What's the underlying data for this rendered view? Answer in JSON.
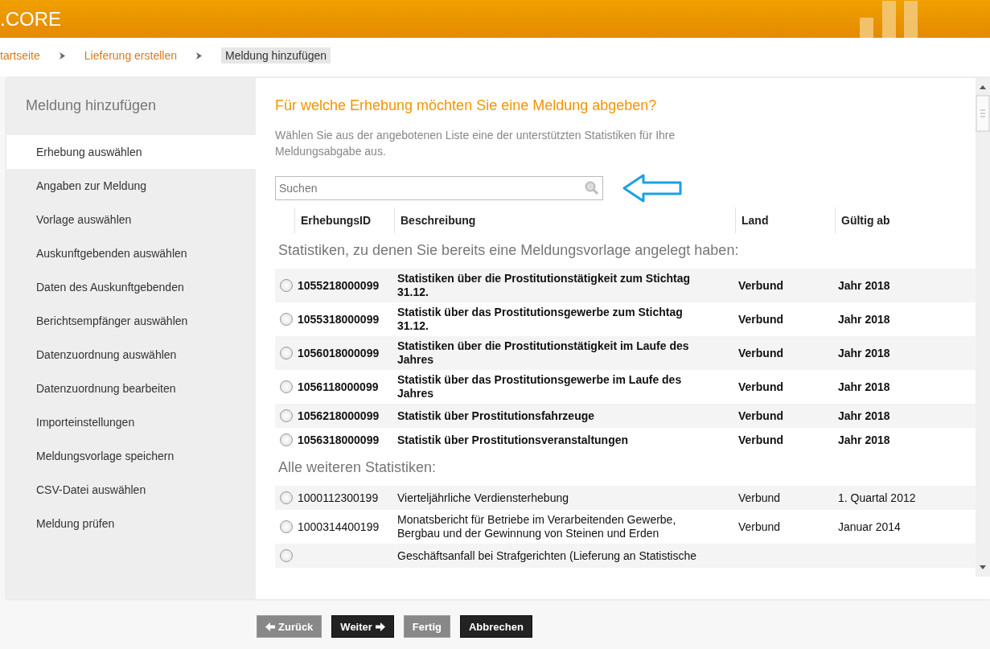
{
  "header": {
    "logo": ".CORE"
  },
  "breadcrumb": [
    {
      "label": "tartseite",
      "current": false
    },
    {
      "label": "Lieferung erstellen",
      "current": false
    },
    {
      "label": "Meldung hinzufügen",
      "current": true
    }
  ],
  "sidebar": {
    "title": "Meldung hinzufügen",
    "items": [
      {
        "label": "Erhebung auswählen",
        "selected": true
      },
      {
        "label": "Angaben zur Meldung",
        "selected": false
      },
      {
        "label": "Vorlage auswählen",
        "selected": false
      },
      {
        "label": "Auskunftgebenden auswählen",
        "selected": false
      },
      {
        "label": "Daten des Auskunftgebenden",
        "selected": false
      },
      {
        "label": "Berichtsempfänger auswählen",
        "selected": false
      },
      {
        "label": "Datenzuordnung auswählen",
        "selected": false
      },
      {
        "label": "Datenzuordnung bearbeiten",
        "selected": false
      },
      {
        "label": "Importeinstellungen",
        "selected": false
      },
      {
        "label": "Meldungsvorlage speichern",
        "selected": false
      },
      {
        "label": "CSV-Datei auswählen",
        "selected": false
      },
      {
        "label": "Meldung prüfen",
        "selected": false
      }
    ]
  },
  "content": {
    "heading": "Für welche Erhebung möchten Sie eine Meldung abgeben?",
    "intro": "Wählen Sie aus der angebotenen Liste eine der unterstützten Statistiken für Ihre Meldungsabgabe aus.",
    "search": {
      "placeholder": "Suchen"
    },
    "table": {
      "columns": [
        "ErhebungsID",
        "Beschreibung",
        "Land",
        "Gültig ab"
      ],
      "groups": [
        {
          "title": "Statistiken, zu denen Sie bereits eine Meldungsvorlage angelegt haben:",
          "bold": true,
          "rows": [
            {
              "id": "1055218000099",
              "description": "Statistiken über die Prostitutionstätigkeit zum Stichtag 31.12.",
              "land": "Verbund",
              "valid_from": "Jahr 2018",
              "selected": false
            },
            {
              "id": "1055318000099",
              "description": "Statistik über das Prostitutionsgewerbe zum Stichtag 31.12.",
              "land": "Verbund",
              "valid_from": "Jahr 2018",
              "selected": false
            },
            {
              "id": "1056018000099",
              "description": "Statistiken über die Prostitutionstätigkeit im Laufe des Jahres",
              "land": "Verbund",
              "valid_from": "Jahr 2018",
              "selected": false
            },
            {
              "id": "1056118000099",
              "description": "Statistik über das Prostitutionsgewerbe im Laufe des Jahres",
              "land": "Verbund",
              "valid_from": "Jahr 2018",
              "selected": false
            },
            {
              "id": "1056218000099",
              "description": "Statistik über Prostitutionsfahrzeuge",
              "land": "Verbund",
              "valid_from": "Jahr 2018",
              "selected": false
            },
            {
              "id": "1056318000099",
              "description": "Statistik über Prostitutionsveranstaltungen",
              "land": "Verbund",
              "valid_from": "Jahr 2018",
              "selected": false
            }
          ]
        },
        {
          "title": "Alle weiteren Statistiken:",
          "bold": false,
          "rows": [
            {
              "id": "1000112300199",
              "description": "Vierteljährliche Verdiensterhebung",
              "land": "Verbund",
              "valid_from": "1. Quartal 2012",
              "selected": false
            },
            {
              "id": "1000314400199",
              "description": "Monatsbericht für Betriebe im Verarbeitenden Gewerbe, Bergbau und der Gewinnung von Steinen und Erden",
              "land": "Verbund",
              "valid_from": "Januar 2014",
              "selected": false
            },
            {
              "description": "Geschäftsanfall bei Strafgerichten (Lieferung an Statistische",
              "selected": false
            }
          ]
        }
      ]
    }
  },
  "buttons": [
    {
      "label": "Zurück",
      "disabled": true,
      "kind": "back"
    },
    {
      "label": "Weiter",
      "disabled": false,
      "kind": "next"
    },
    {
      "label": "Fertig",
      "disabled": true,
      "kind": "plain"
    },
    {
      "label": "Abbrechen",
      "disabled": false,
      "kind": "plain"
    }
  ]
}
